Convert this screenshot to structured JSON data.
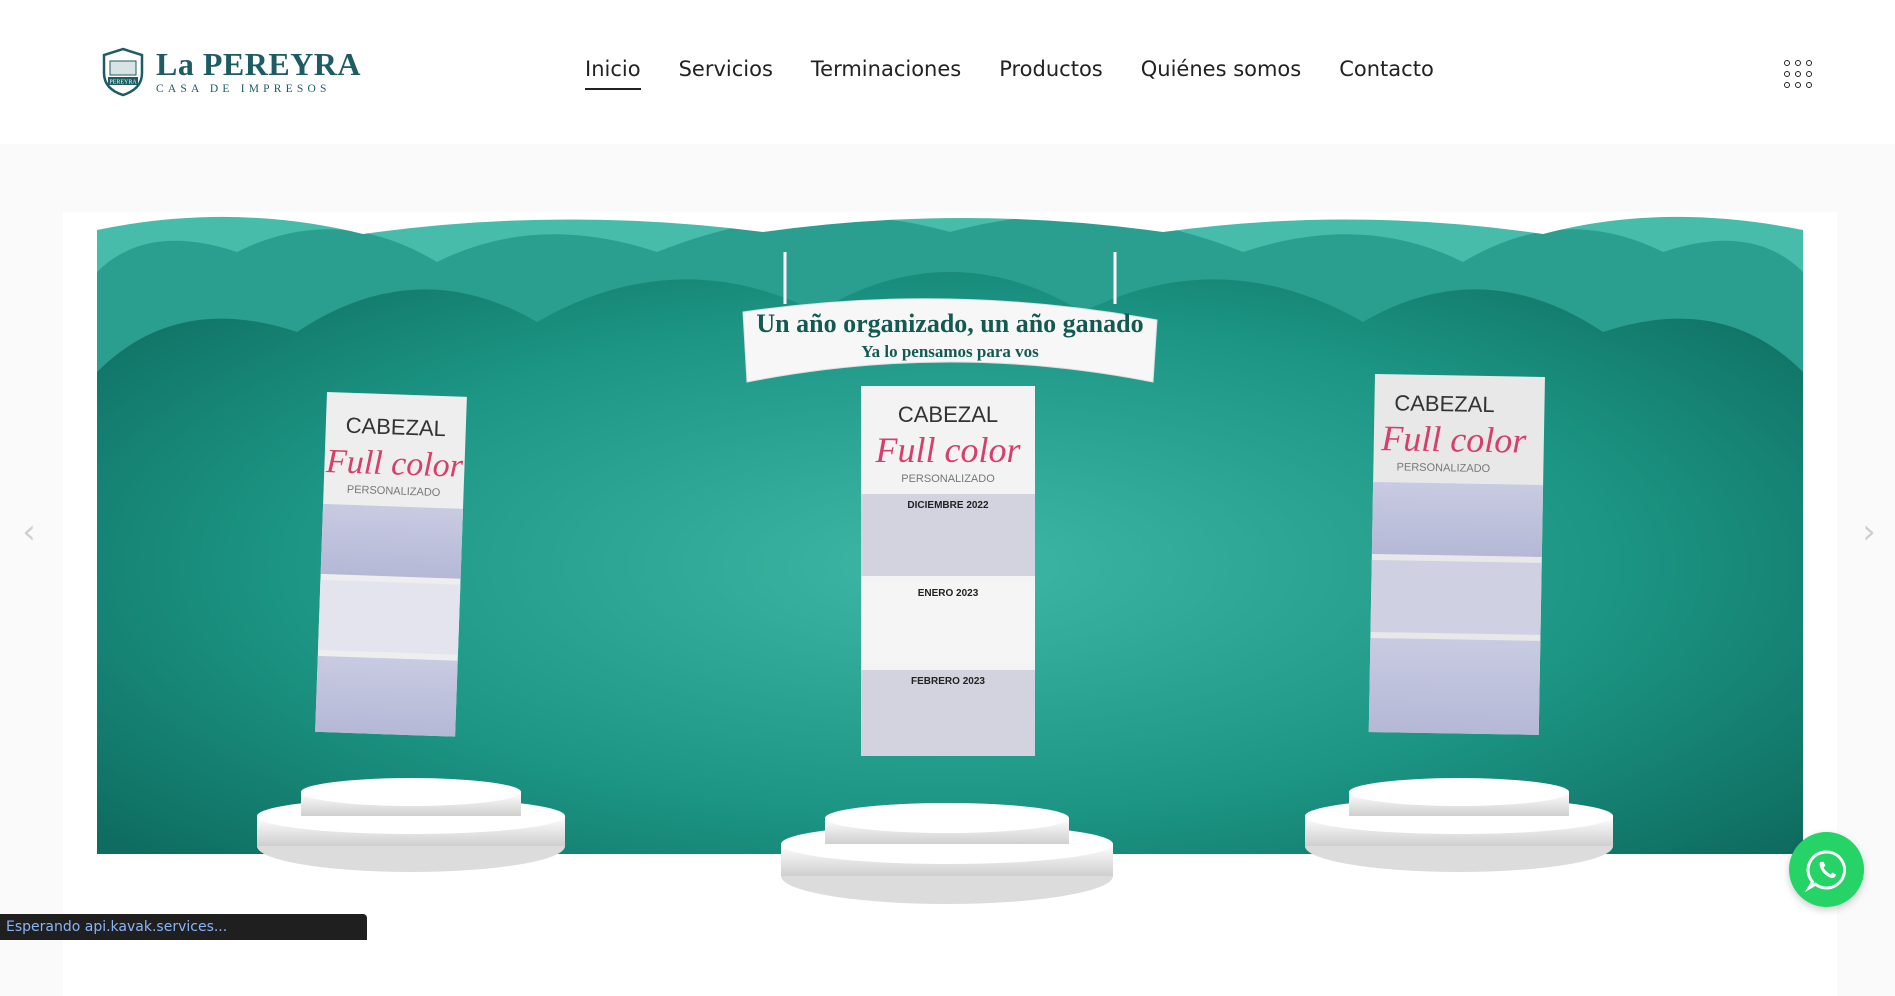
{
  "brand": {
    "title": "La PEREYRA",
    "subtitle": "CASA DE IMPRESOS",
    "color": "#1d5c64"
  },
  "nav": {
    "items": [
      {
        "label": "Inicio",
        "active": true
      },
      {
        "label": "Servicios"
      },
      {
        "label": "Terminaciones"
      },
      {
        "label": "Productos"
      },
      {
        "label": "Quiénes somos"
      },
      {
        "label": "Contacto"
      }
    ],
    "menu_icon": "grid-dots-icon"
  },
  "slider": {
    "banner_line1": "Un año organizado, un año ganado",
    "banner_line2": "Ya lo pensamos para vos",
    "calendars": [
      {
        "header": "CABEZAL",
        "script": "Full color",
        "tag": "PERSONALIZADO"
      },
      {
        "header": "CABEZAL",
        "script": "Full color",
        "tag": "PERSONALIZADO",
        "months": [
          "DICIEMBRE 2022",
          "ENERO 2023",
          "FEBRERO 2023"
        ]
      },
      {
        "header": "CABEZAL",
        "script": "Full color",
        "tag": "PERSONALIZADO"
      }
    ],
    "prev_icon": "chevron-left-icon",
    "next_icon": "chevron-right-icon",
    "teal": "#1f9e8c"
  },
  "status": {
    "text": "Esperando api.kavak.services..."
  },
  "whatsapp": {
    "icon": "whatsapp-icon",
    "color": "#25d366"
  }
}
